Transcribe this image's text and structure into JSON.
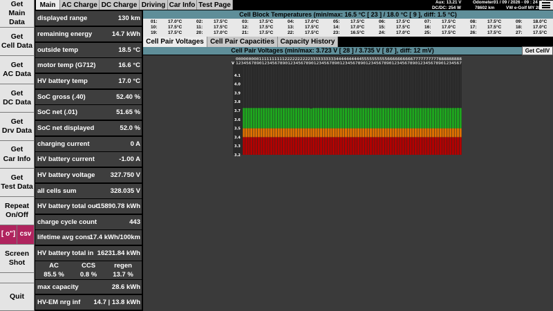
{
  "left_buttons": [
    {
      "name": "get-main-data-button",
      "label": "Get\nMain Data"
    },
    {
      "name": "get-cell-data-button",
      "label": "Get\nCell Data"
    },
    {
      "name": "get-ac-data-button",
      "label": "Get\nAC Data"
    },
    {
      "name": "get-dc-data-button",
      "label": "Get\nDC Data"
    },
    {
      "name": "get-drv-data-button",
      "label": "Get\nDrv Data"
    },
    {
      "name": "get-car-info-button",
      "label": "Get\nCar Info"
    },
    {
      "name": "get-test-data-button",
      "label": "Get\nTest Data"
    },
    {
      "name": "repeat-onoff-button",
      "label": "Repeat\nOn/Off"
    },
    {
      "name": "screenshot-button",
      "label": "Screen\nShot"
    },
    {
      "name": "quit-button",
      "label": "Quit"
    }
  ],
  "small_buttons": {
    "o_label": "[ o\"]",
    "csv_label": "csv"
  },
  "data_rows": [
    {
      "label": "displayed range",
      "value": "130 km"
    },
    {
      "label": "remaining energy",
      "value": "14.7 kWh"
    },
    {
      "label": "outside temp",
      "value": "18.5 °C"
    },
    {
      "label": "motor temp (G712)",
      "value": "16.6 °C"
    },
    {
      "label": "HV battery temp",
      "value": "17.0 °C"
    },
    {
      "label": "SoC gross (.40)",
      "value": "52.40 %"
    },
    {
      "label": "SoC net (.01)",
      "value": "51.65 %"
    },
    {
      "label": "SoC net displayed",
      "value": "52.0 %"
    },
    {
      "label": "charging current",
      "value": "0 A"
    },
    {
      "label": "HV battery current",
      "value": "-1.00 A"
    },
    {
      "label": "HV battery voltage",
      "value": "327.750 V"
    },
    {
      "label": "all cells sum",
      "value": "328.035 V"
    },
    {
      "label": "HV battery total out",
      "value": "-15890.78 kWh"
    },
    {
      "label": "charge cycle count",
      "value": "443"
    },
    {
      "label": "lifetime avg cons",
      "value": "17.4 kWh/100km"
    },
    {
      "label": "HV battery total in",
      "value": "16231.84 kWh"
    }
  ],
  "charge_split": {
    "headers": [
      "AC",
      "CCS",
      "regen"
    ],
    "values": [
      "85.5 %",
      "0.8 %",
      "13.7 %"
    ]
  },
  "bottom_rows": [
    {
      "label": "max capacity",
      "value": "28.6 kWh"
    },
    {
      "label": "HV-EM nrg inf",
      "value": "14.7 | 13.8 kWh"
    }
  ],
  "tabs": [
    "Main",
    "AC Charge",
    "DC Charge",
    "Driving",
    "Car Info",
    "Test Page"
  ],
  "status": {
    "aux": "Aux: 13.21 V",
    "dcdc": "DC/DC: 254 W",
    "odometer_label": "Odometer:",
    "odometer_value": "78602 km",
    "datetime": "01 / 09 / 2026  -  09 : 24 : 56",
    "vehicle": "VW e-Golf MY 2020"
  },
  "cell_block": {
    "title": "Cell Block Temperatures (min/max:  16.5 °C [ 23 ]  /  18.0 °C [ 9 ],  diff:  1.5 °C)",
    "cells": [
      {
        "n": "01:",
        "t": "17.0°C"
      },
      {
        "n": "02:",
        "t": "17.5°C"
      },
      {
        "n": "03:",
        "t": "17.5°C"
      },
      {
        "n": "04:",
        "t": "17.0°C"
      },
      {
        "n": "05:",
        "t": "17.5°C"
      },
      {
        "n": "06:",
        "t": "17.5°C"
      },
      {
        "n": "07:",
        "t": "17.5°C"
      },
      {
        "n": "08:",
        "t": "17.5°C"
      },
      {
        "n": "09:",
        "t": "18.0°C"
      },
      {
        "n": "10:",
        "t": "17.5°C"
      },
      {
        "n": "11:",
        "t": "17.5°C"
      },
      {
        "n": "12:",
        "t": "17.5°C"
      },
      {
        "n": "13:",
        "t": "17.5°C"
      },
      {
        "n": "14:",
        "t": "17.0°C"
      },
      {
        "n": "15:",
        "t": "17.5°C"
      },
      {
        "n": "16:",
        "t": "17.0°C"
      },
      {
        "n": "17:",
        "t": "17.5°C"
      },
      {
        "n": "18:",
        "t": "17.0°C"
      },
      {
        "n": "19:",
        "t": "17.5°C"
      },
      {
        "n": "20:",
        "t": "17.0°C"
      },
      {
        "n": "21:",
        "t": "17.5°C"
      },
      {
        "n": "22:",
        "t": "17.5°C"
      },
      {
        "n": "23:",
        "t": "16.5°C"
      },
      {
        "n": "24:",
        "t": "17.0°C"
      },
      {
        "n": "25:",
        "t": "17.5°C"
      },
      {
        "n": "26:",
        "t": "17.5°C"
      },
      {
        "n": "27:",
        "t": "17.5°C"
      }
    ]
  },
  "sub_tabs": [
    "Cell Pair Voltages",
    "Cell Pair Capacities",
    "Capacity History"
  ],
  "cell_voltage_title": "Cell Pair Voltages (min/max:  3.723 V  [ 28 ]  /  3.735 V  [ 87 ],  diff:  12 mV)",
  "get_cellv_label": "Get CellV",
  "chart_data": {
    "type": "bar",
    "count": 88,
    "min_value": 3.723,
    "min_index": 28,
    "max_value": 3.735,
    "max_index": 87,
    "typical_value": 3.729,
    "axis_label": "V",
    "index_tens_row": "0000000001111111111222222222233333333334444444444555555555566666666667777777777888888888",
    "index_ones_row": "123456789012345678901234567890123456789012345678901234567890123456789012345678901234567",
    "ylim": [
      3.2,
      4.2
    ],
    "yticks": [
      "4.1",
      "4.0",
      "3.9",
      "3.8",
      "3.7",
      "3.6",
      "3.5",
      "3.4",
      "3.3",
      "3.2"
    ],
    "bands": [
      {
        "from": 3.2,
        "to": 3.4,
        "color": "#b40000"
      },
      {
        "from": 3.4,
        "to": 3.5,
        "color": "#e07000"
      },
      {
        "from": 3.5,
        "to": 3.73,
        "color": "#1ea81e"
      }
    ]
  }
}
